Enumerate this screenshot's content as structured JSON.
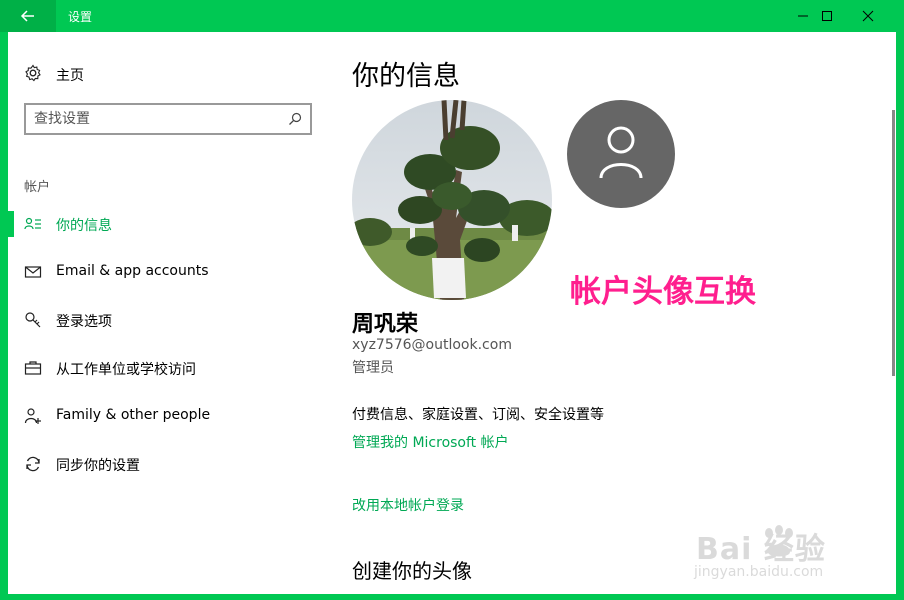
{
  "window": {
    "title": "设置"
  },
  "sidebar": {
    "home_label": "主页",
    "search_placeholder": "查找设置",
    "section_label": "帐户",
    "items": [
      {
        "label": "你的信息",
        "icon": "person-list-icon",
        "active": true
      },
      {
        "label": "Email & app accounts",
        "icon": "mail-icon"
      },
      {
        "label": "登录选项",
        "icon": "key-icon"
      },
      {
        "label": "从工作单位或学校访问",
        "icon": "briefcase-icon"
      },
      {
        "label": "Family & other people",
        "icon": "person-add-icon"
      },
      {
        "label": "同步你的设置",
        "icon": "sync-icon"
      }
    ]
  },
  "main": {
    "title": "你的信息",
    "overlay_text": "帐户头像互换",
    "user": {
      "name": "周巩荣",
      "email": "xyz7576@outlook.com",
      "role": "管理员"
    },
    "billing_text": "付费信息、家庭设置、订阅、安全设置等",
    "manage_link": "管理我的 Microsoft 帐户",
    "local_link": "改用本地帐户登录",
    "create_avatar_title": "创建你的头像"
  },
  "watermark": {
    "logo": "Bai 经验",
    "url": "jingyan.baidu.com"
  },
  "colors": {
    "accent": "#00c853",
    "link": "#00a854",
    "overlay": "#ff1f8e"
  }
}
